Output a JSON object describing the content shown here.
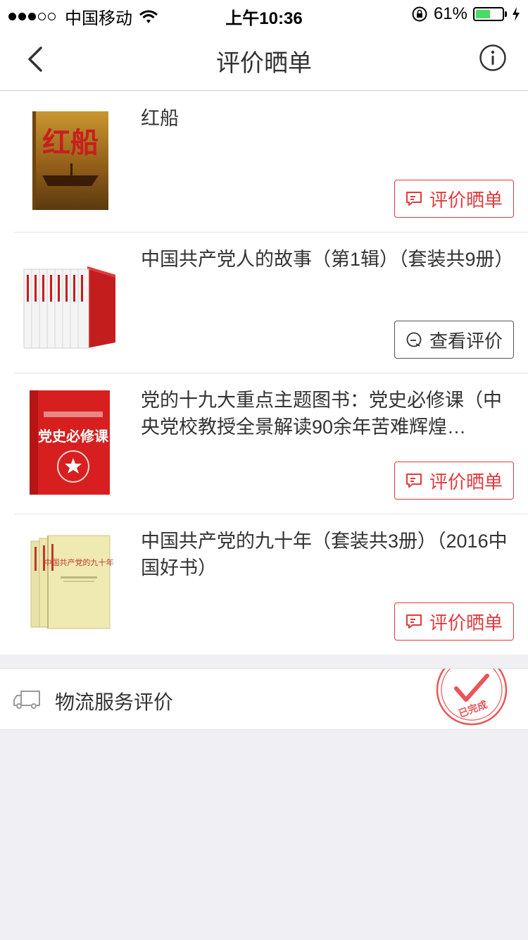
{
  "status_bar": {
    "carrier": "中国移动",
    "time": "上午10:36",
    "battery_percent": "61%",
    "battery_level": 0.61,
    "signal_bars_filled": 3,
    "signal_bars_total": 5
  },
  "nav": {
    "title": "评价晒单",
    "back_icon": "chevron-left-icon",
    "info_icon": "info-icon"
  },
  "orders": [
    {
      "title": "红船",
      "action_label": "评价晒单",
      "action_type": "review"
    },
    {
      "title": "中国共产党人的故事（第1辑）（套装共9册）",
      "action_label": "查看评价",
      "action_type": "view"
    },
    {
      "title": "党的十九大重点主题图书：党史必修课（中央党校教授全景解读90余年苦难辉煌…",
      "action_label": "评价晒单",
      "action_type": "review"
    },
    {
      "title": "中国共产党的九十年（套装共3册）（2016中国好书）",
      "action_label": "评价晒单",
      "action_type": "review"
    }
  ],
  "covers": {
    "book1": {
      "main_text": "红船"
    },
    "book3": {
      "main_text": "党史必修课"
    },
    "book4": {
      "main_text": "中国共产党的九十年"
    }
  },
  "logistics": {
    "label": "物流服务评价",
    "stamp_text": "已完成"
  },
  "colors": {
    "accent": "#e4393c",
    "background": "#efeff4",
    "battery": "#4cd964"
  }
}
